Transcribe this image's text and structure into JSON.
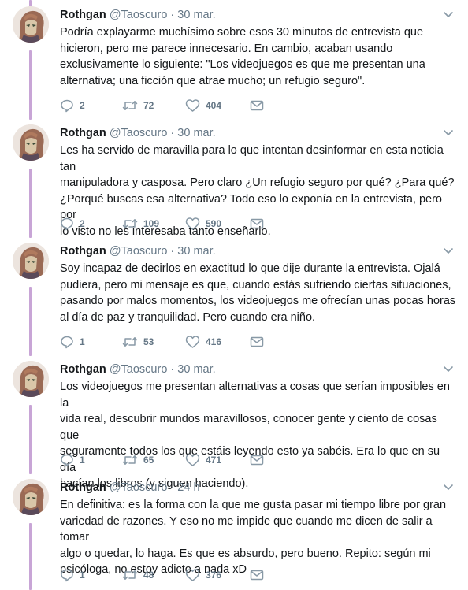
{
  "tweets": [
    {
      "name": "Rothgan",
      "handle": "@Taoscuro",
      "separator": "·",
      "date": "30 mar.",
      "lines": [
        "Podría explayarme muchísimo sobre esos 30 minutos de entrevista que",
        "hicieron, pero me parece innecesario. En cambio, acaban usando",
        "exclusivamente lo siguiente: \"Los videojuegos es que me presentan una",
        "alternativa; una ficción que atrae mucho; un refugio seguro\"."
      ],
      "replies": "2",
      "retweets": "72",
      "likes": "404"
    },
    {
      "name": "Rothgan",
      "handle": "@Taoscuro",
      "separator": "·",
      "date": "30 mar.",
      "lines": [
        "Les ha servido de maravilla para lo que intentan desinformar en esta noticia tan",
        "manipuladora y casposa. Pero claro ¿Un refugio seguro por qué? ¿Para qué?",
        "¿Porqué buscas esa alternativa? Todo eso lo exponía en la entrevista, pero por",
        "lo visto no les interesaba tanto enseñarlo."
      ],
      "replies": "2",
      "retweets": "109",
      "likes": "590"
    },
    {
      "name": "Rothgan",
      "handle": "@Taoscuro",
      "separator": "·",
      "date": "30 mar.",
      "lines": [
        "Soy incapaz de decirlos en exactitud lo que dije durante la entrevista. Ojalá",
        "pudiera, pero mi mensaje es que, cuando estás sufriendo ciertas situaciones,",
        "pasando por malos momentos, los videojuegos me ofrecían unas pocas horas",
        "al día de paz y tranquilidad. Pero cuando era niño."
      ],
      "replies": "1",
      "retweets": "53",
      "likes": "416"
    },
    {
      "name": "Rothgan",
      "handle": "@Taoscuro",
      "separator": "·",
      "date": "30 mar.",
      "lines": [
        "Los videojuegos me presentan alternativas a cosas que serían imposibles en la",
        "vida real, descubrir mundos maravillosos, conocer gente y ciento de cosas que",
        "seguramente todos los que estáis leyendo esto ya sabéis. Era lo que en su día",
        "hacían los libros (y siguen haciendo)."
      ],
      "replies": "1",
      "retweets": "65",
      "likes": "471"
    },
    {
      "name": "Rothgan",
      "handle": "@Taoscuro",
      "separator": "·",
      "date": "24 h",
      "lines": [
        "En definitiva: es la forma con la que me gusta pasar mi tiempo libre por gran",
        "variedad de razones. Y eso no me impide que cuando me dicen de salir a tomar",
        "algo o quedar, lo haga. Es que es absurdo, pero bueno. Repito: según mi",
        "psicóloga, no estoy adicto a nada xD"
      ],
      "replies": "1",
      "retweets": "48",
      "likes": "376"
    }
  ],
  "icons": {
    "reply": "reply-icon",
    "retweet": "retweet-icon",
    "like": "heart-icon",
    "message": "envelope-icon",
    "menu": "chevron-down-icon"
  },
  "colors": {
    "thread_line": "#c8a5d6",
    "meta_text": "#657786",
    "icon": "#8899a6"
  }
}
